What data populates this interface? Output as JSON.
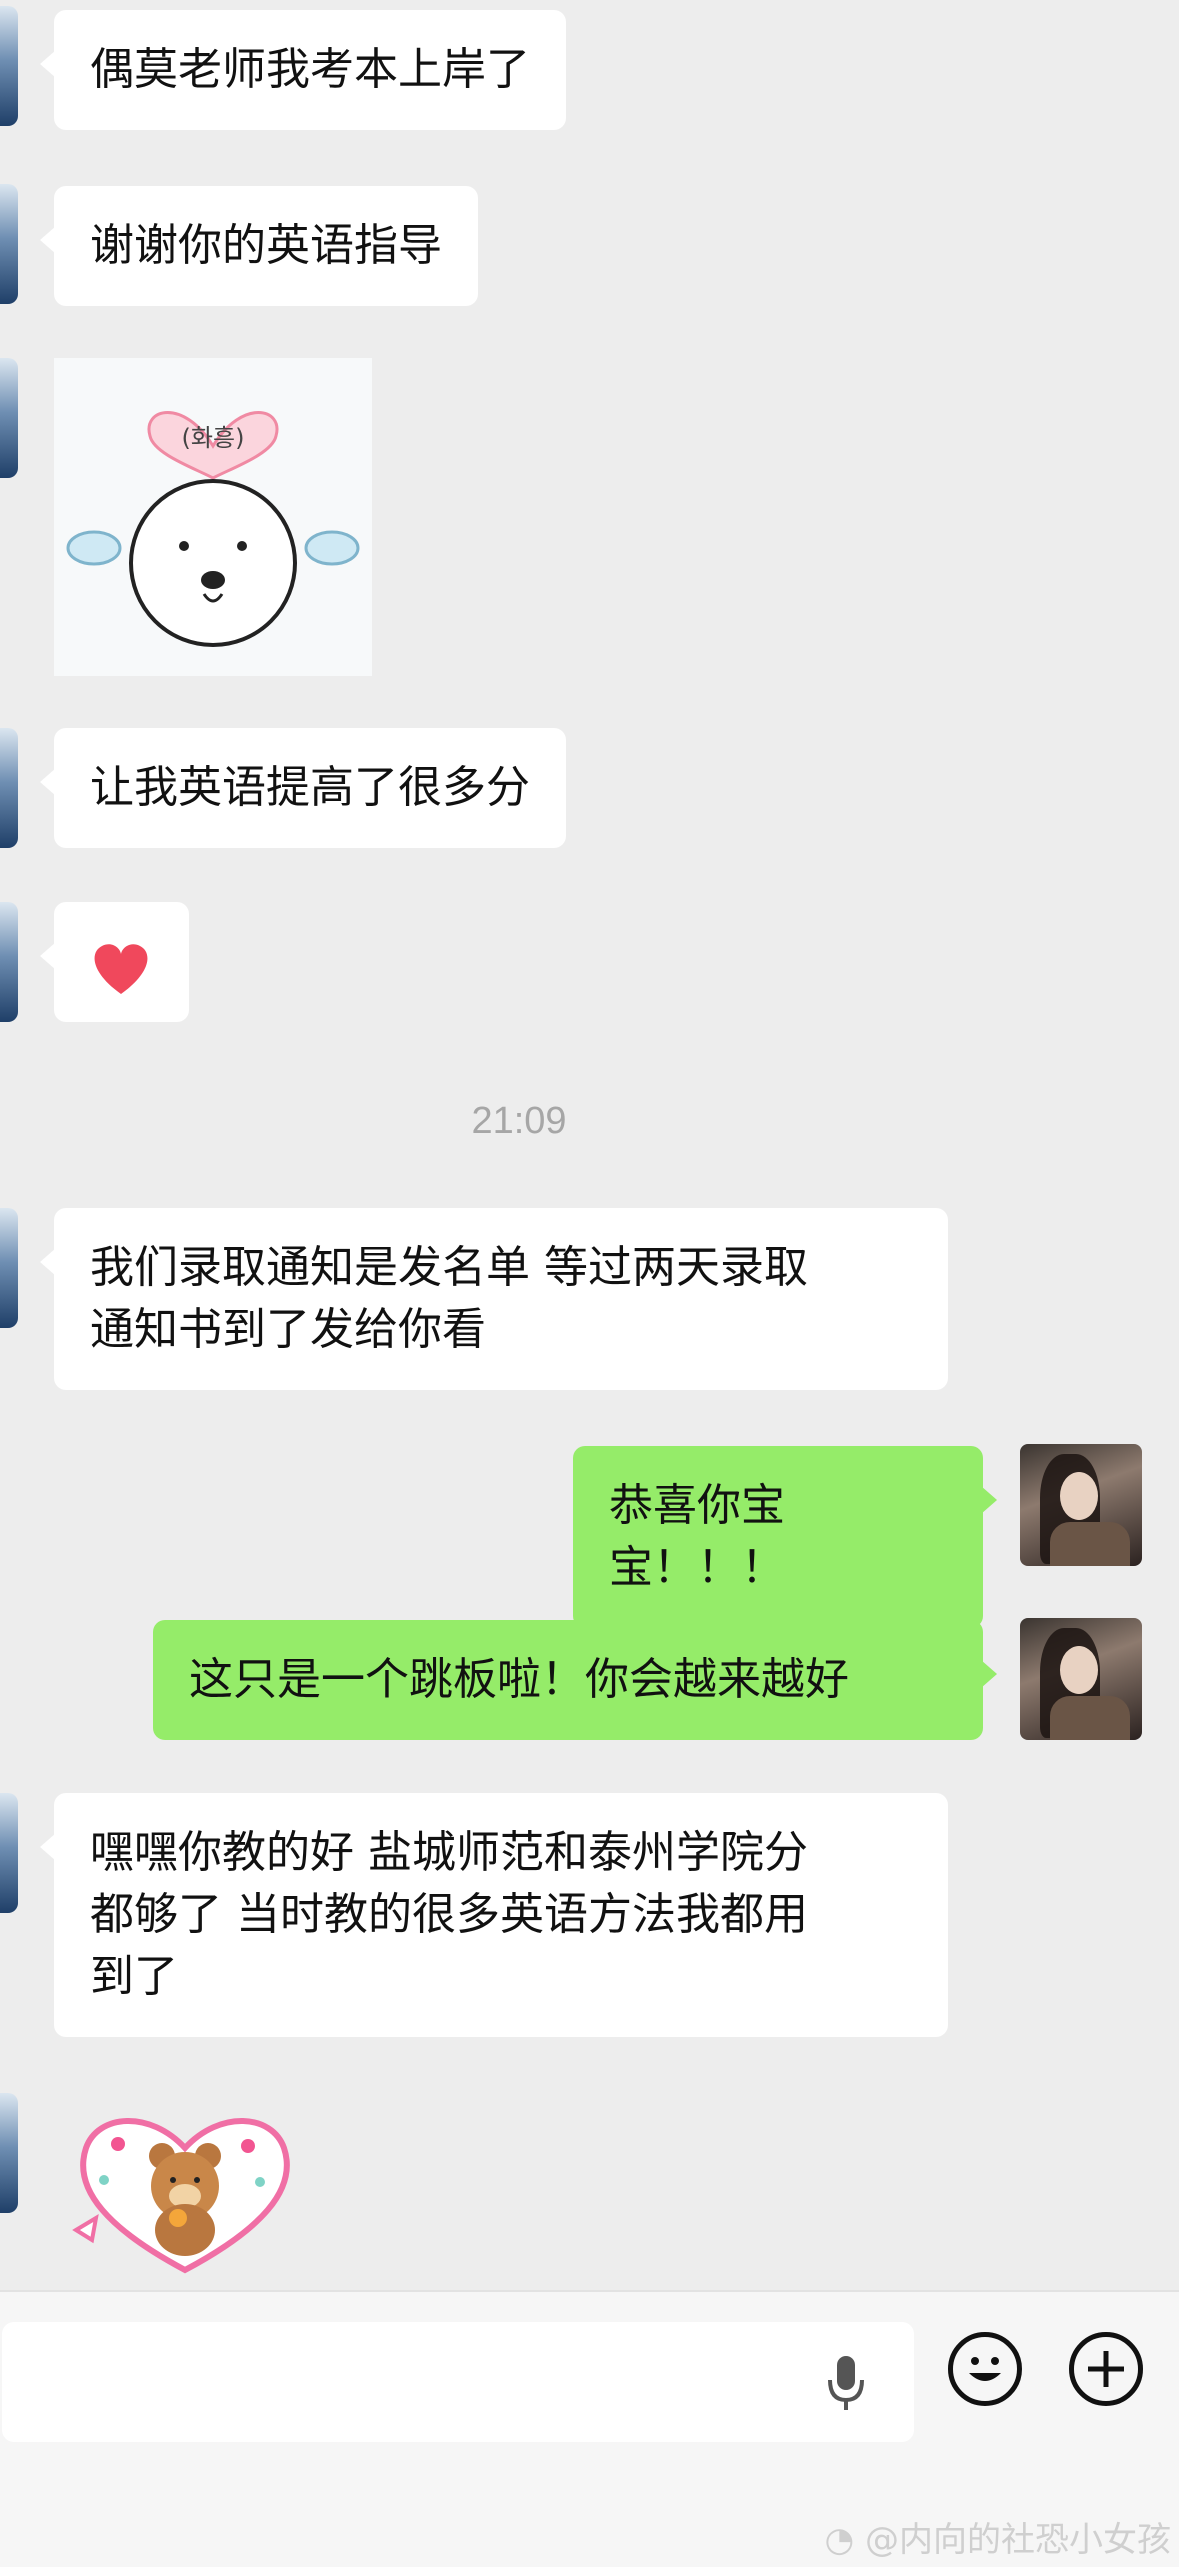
{
  "messages": [
    {
      "side": "left",
      "text": "偶莫老师我考本上岸了"
    },
    {
      "side": "left",
      "text": "谢谢你的英语指导"
    },
    {
      "side": "left",
      "type": "sticker",
      "sticker_text": "(화흥)"
    },
    {
      "side": "left",
      "text": "让我英语提高了很多分"
    },
    {
      "side": "left",
      "type": "emoji",
      "emoji": "❤"
    },
    {
      "side": "left",
      "line1": "我们录取通知是发名单 等过两天录取",
      "line2": "通知书到了发给你看"
    },
    {
      "side": "right",
      "text": "恭喜你宝宝！！！"
    },
    {
      "side": "right",
      "text": "这只是一个跳板啦！你会越来越好"
    },
    {
      "side": "left",
      "line1": "嘿嘿你教的好 盐城师范和泰州学院分",
      "line2": "都够了 当时教的很多英语方法我都用",
      "line3": "到了"
    },
    {
      "side": "left",
      "type": "sticker",
      "sticker_name": "bear-heart-sticker"
    }
  ],
  "timestamp": "21:09",
  "input": {
    "value": "",
    "placeholder": ""
  },
  "icons": {
    "mic": "microphone-icon",
    "emoji": "smiley-icon",
    "plus": "plus-icon"
  },
  "colors": {
    "background": "#ededed",
    "left_bubble": "#ffffff",
    "right_bubble": "#95ec69"
  },
  "watermark": "@内向的社恐小女孩"
}
